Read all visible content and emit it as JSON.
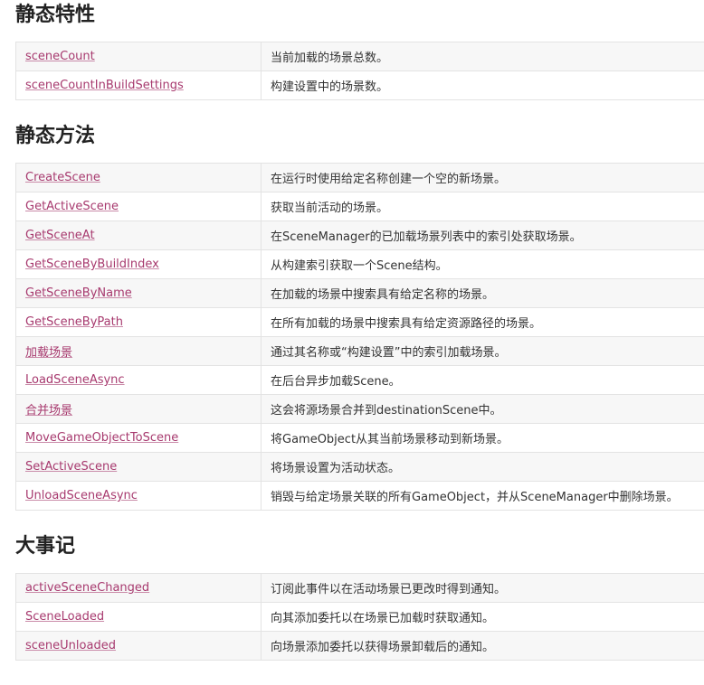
{
  "static_properties": {
    "title": "静态特性",
    "rows": [
      {
        "name": "sceneCount",
        "desc": "当前加载的场景总数。"
      },
      {
        "name": "sceneCountInBuildSettings",
        "desc": "构建设置中的场景数。"
      }
    ]
  },
  "static_methods": {
    "title": "静态方法",
    "rows": [
      {
        "name": "CreateScene",
        "desc": "在运行时使用给定名称创建一个空的新场景。"
      },
      {
        "name": "GetActiveScene",
        "desc": "获取当前活动的场景。"
      },
      {
        "name": "GetSceneAt",
        "desc": "在SceneManager的已加载场景列表中的索引处获取场景。"
      },
      {
        "name": "GetSceneByBuildIndex",
        "desc": "从构建索引获取一个Scene结构。"
      },
      {
        "name": "GetSceneByName",
        "desc": "在加载的场景中搜索具有给定名称的场景。"
      },
      {
        "name": "GetSceneByPath",
        "desc": "在所有加载的场景中搜索具有给定资源路径的场景。"
      },
      {
        "name": "加载场景",
        "desc": "通过其名称或“构建设置”中的索引加载场景。"
      },
      {
        "name": "LoadSceneAsync",
        "desc": "在后台异步加载Scene。"
      },
      {
        "name": "合并场景",
        "desc": "这会将源场景合并到destinationScene中。"
      },
      {
        "name": "MoveGameObjectToScene",
        "desc": "将GameObject从其当前场景移动到新场景。"
      },
      {
        "name": "SetActiveScene",
        "desc": "将场景设置为活动状态。"
      },
      {
        "name": "UnloadSceneAsync",
        "desc": "销毁与给定场景关联的所有GameObject，并从SceneManager中删除场景。"
      }
    ]
  },
  "events": {
    "title": "大事记",
    "rows": [
      {
        "name": "activeSceneChanged",
        "desc": "订阅此事件以在活动场景已更改时得到通知。"
      },
      {
        "name": "SceneLoaded",
        "desc": "向其添加委托以在场景已加载时获取通知。"
      },
      {
        "name": "sceneUnloaded",
        "desc": "向场景添加委托以获得场景卸载后的通知。"
      }
    ]
  }
}
